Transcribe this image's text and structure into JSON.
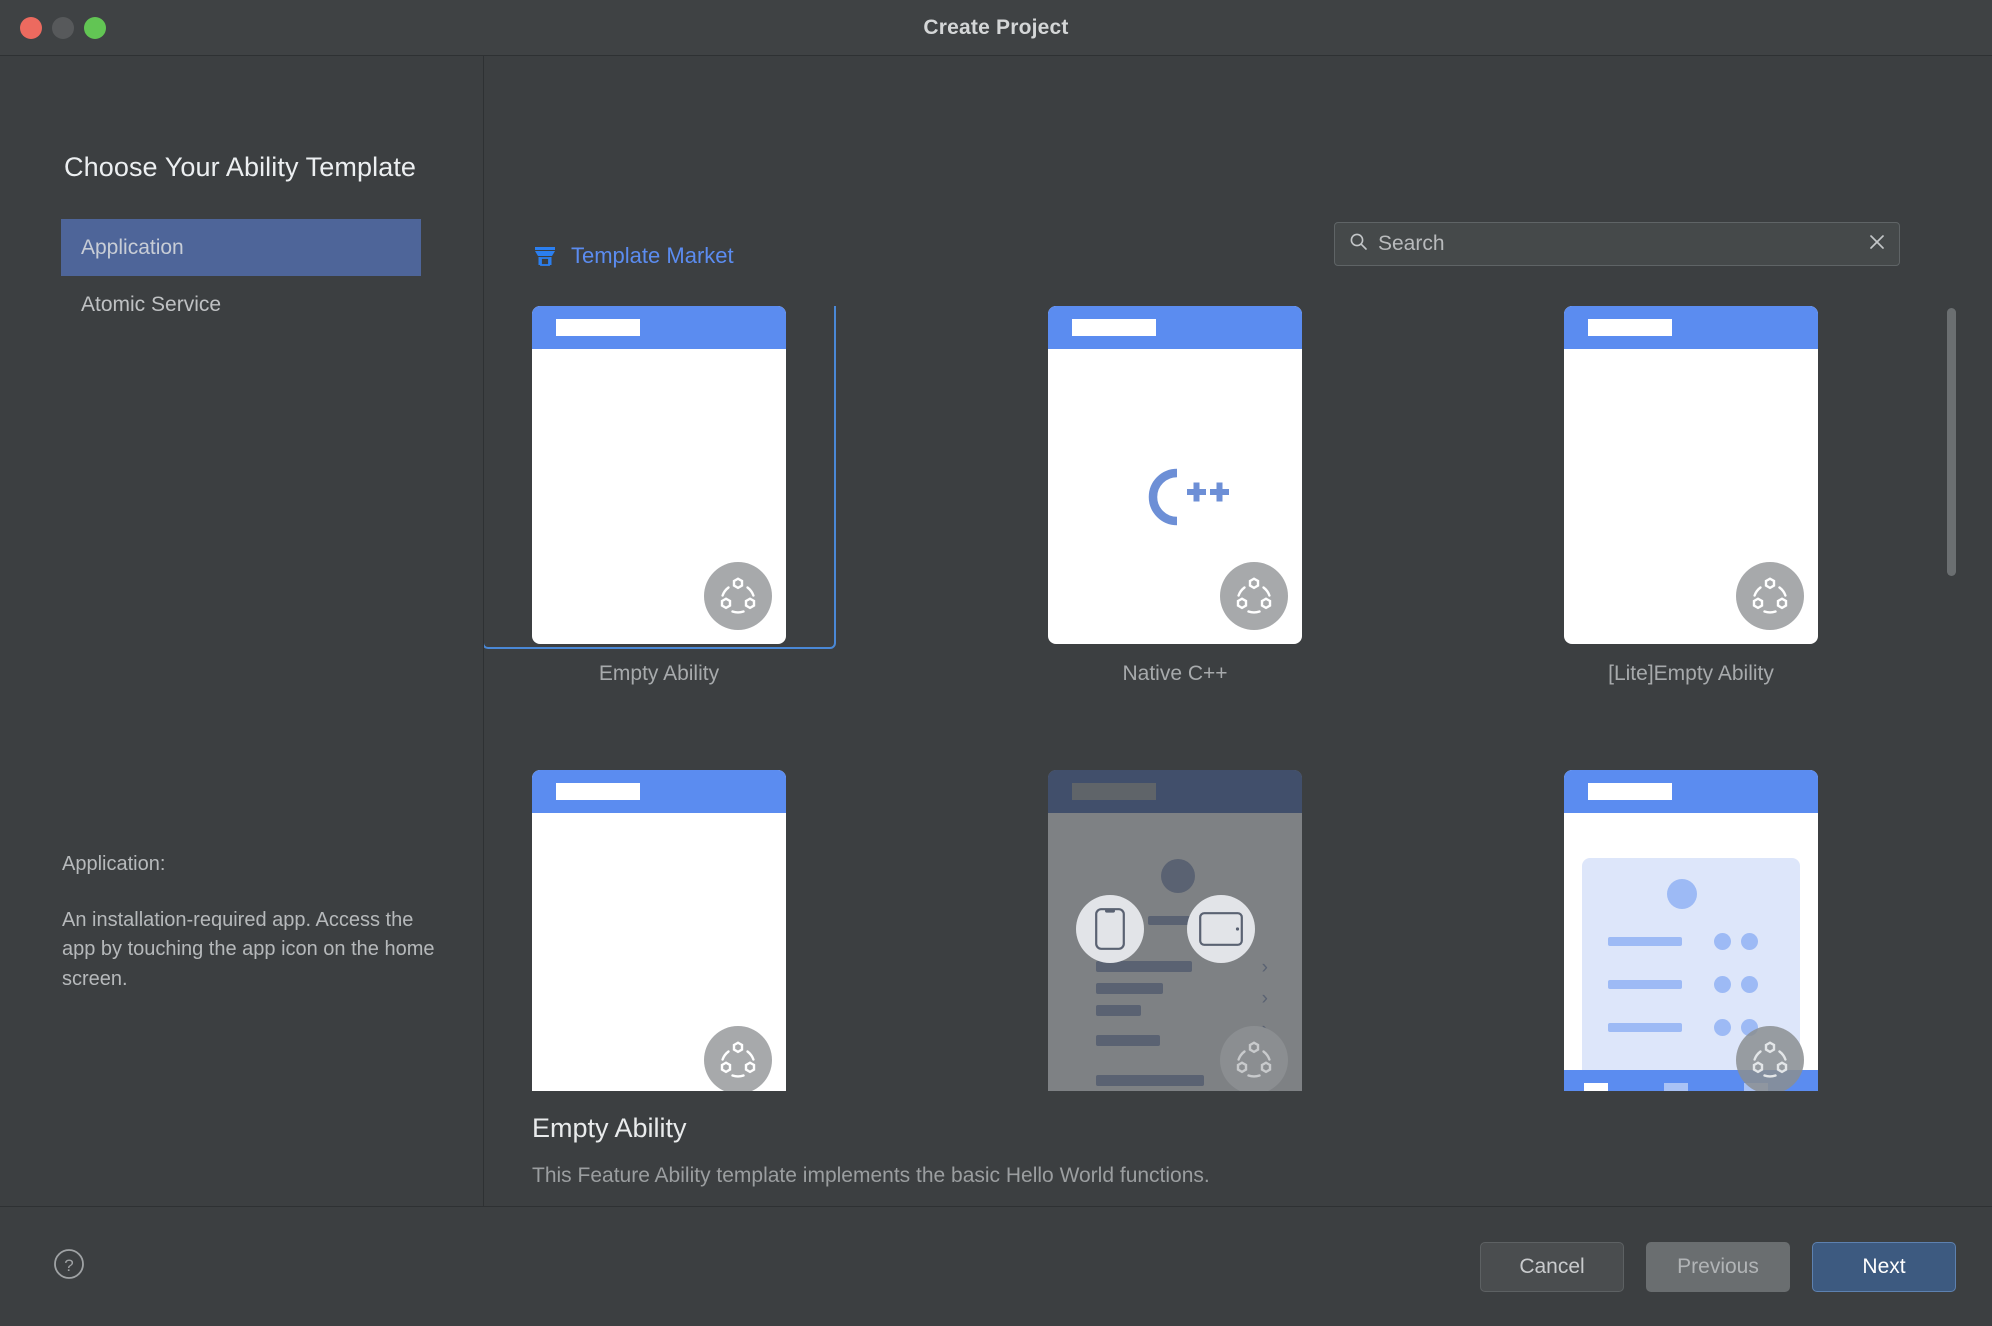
{
  "window": {
    "title": "Create Project",
    "traffic_lights": [
      "close",
      "minimize",
      "zoom"
    ]
  },
  "left_panel": {
    "heading": "Choose Your Ability Template",
    "categories": [
      {
        "label": "Application",
        "selected": true
      },
      {
        "label": "Atomic Service",
        "selected": false
      }
    ],
    "description_title": "Application:",
    "description_text": "An installation-required app. Access the app by touching the app icon on the home screen."
  },
  "right_panel": {
    "market_label": "Template Market",
    "market_icon": "shop-icon",
    "search": {
      "placeholder": "Search",
      "value": "",
      "icon": "search-icon",
      "clear_icon": "close-icon"
    },
    "templates": [
      {
        "label": "Empty Ability",
        "selected": true,
        "style": "blank"
      },
      {
        "label": "Native C++",
        "selected": false,
        "style": "cpp",
        "glyph": "C++"
      },
      {
        "label": "[Lite]Empty Ability",
        "selected": false,
        "style": "blank"
      },
      {
        "label": "",
        "selected": false,
        "style": "blank"
      },
      {
        "label": "",
        "selected": false,
        "style": "dark-list"
      },
      {
        "label": "",
        "selected": false,
        "style": "blue-list"
      }
    ],
    "selected_template": {
      "name": "Empty Ability",
      "description": "This Feature Ability template implements the basic Hello World functions."
    }
  },
  "footer": {
    "help_icon": "help-icon",
    "buttons": {
      "cancel": "Cancel",
      "previous": "Previous",
      "next": "Next"
    }
  },
  "colors": {
    "accent_blue": "#5b8cf0",
    "selection_blue": "#4e6599",
    "next_button_blue": "#3d5a80",
    "background": "#3c3f41",
    "close_red": "#ec6a5f",
    "zoom_green": "#62c554"
  }
}
